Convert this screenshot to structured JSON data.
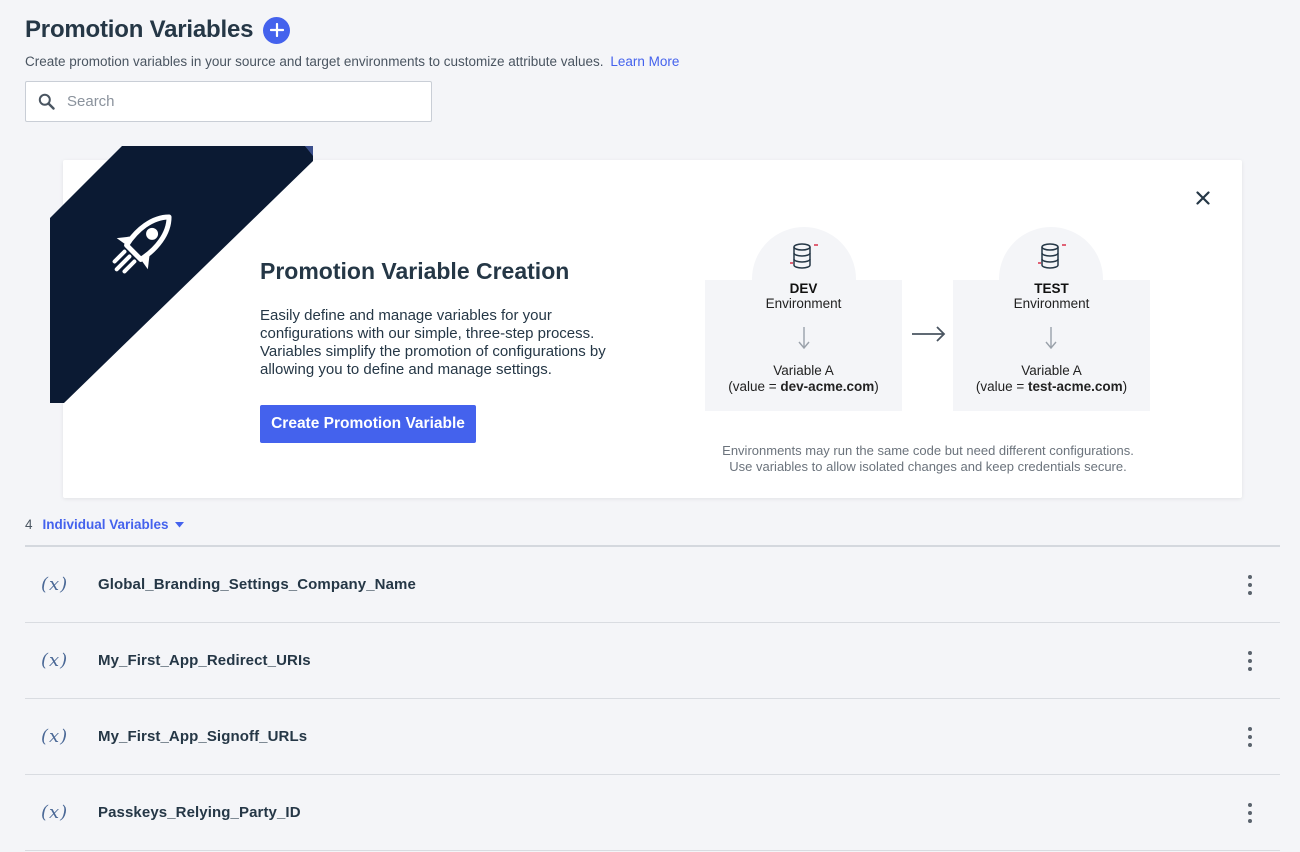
{
  "header": {
    "title": "Promotion Variables",
    "subtitle": "Create promotion variables in your source and target environments to customize attribute values.",
    "learn_more": "Learn More"
  },
  "search": {
    "placeholder": "Search"
  },
  "promo": {
    "title": "Promotion Variable Creation",
    "description": "Easily define and manage variables for your configurations with our simple, three-step process. Variables simplify the promotion of configurations by allowing you to define and manage settings.",
    "button": "Create Promotion Variable",
    "environments": [
      {
        "name": "DEV",
        "label": "Environment",
        "variable": "Variable A",
        "value_prefix": "(value = ",
        "value": "dev-acme.com",
        "value_suffix": ")"
      },
      {
        "name": "TEST",
        "label": "Environment",
        "variable": "Variable A",
        "value_prefix": "(value = ",
        "value": "test-acme.com",
        "value_suffix": ")"
      }
    ],
    "note_line1": "Environments may run the same code but need different configurations.",
    "note_line2": "Use variables to allow isolated changes and keep credentials secure."
  },
  "list": {
    "count": "4",
    "filter": "Individual Variables",
    "icon_text": "(x)",
    "items": [
      {
        "name": "Global_Branding_Settings_Company_Name"
      },
      {
        "name": "My_First_App_Redirect_URIs"
      },
      {
        "name": "My_First_App_Signoff_URLs"
      },
      {
        "name": "Passkeys_Relying_Party_ID"
      }
    ]
  },
  "colors": {
    "accent": "#4462ed",
    "ribbon": "#0b1a33",
    "background": "#f4f5f8"
  }
}
